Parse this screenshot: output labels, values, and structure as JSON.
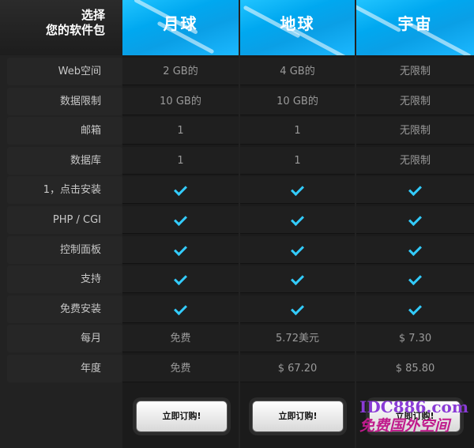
{
  "header": {
    "title_line1": "选择",
    "title_line2": "您的软件包",
    "plans": [
      "月球",
      "地球",
      "宇宙"
    ]
  },
  "rows": [
    {
      "label": "Web空间",
      "values": [
        "2 GB的",
        "4 GB的",
        "无限制"
      ]
    },
    {
      "label": "数据限制",
      "values": [
        "10 GB的",
        "10 GB的",
        "无限制"
      ]
    },
    {
      "label": "邮箱",
      "values": [
        "1",
        "1",
        "无限制"
      ]
    },
    {
      "label": "数据库",
      "values": [
        "1",
        "1",
        "无限制"
      ]
    },
    {
      "label": "1，点击安装",
      "values": [
        "check",
        "check",
        "check"
      ]
    },
    {
      "label": "PHP / CGI",
      "values": [
        "check",
        "check",
        "check"
      ]
    },
    {
      "label": "控制面板",
      "values": [
        "check",
        "check",
        "check"
      ]
    },
    {
      "label": "支持",
      "values": [
        "check",
        "check",
        "check"
      ]
    },
    {
      "label": "免费安装",
      "values": [
        "check",
        "check",
        "check"
      ]
    },
    {
      "label": "每月",
      "values": [
        "免费",
        "5.72美元",
        "$ 7.30"
      ]
    },
    {
      "label": "年度",
      "values": [
        "免费",
        "$ 67.20",
        "$ 85.80"
      ]
    }
  ],
  "buttons": {
    "order_label": "立即订购!"
  },
  "watermark": {
    "line1": "IDC886.com",
    "line2": "免费国外空间"
  },
  "colors": {
    "accent": "#00a8f0",
    "check": "#33ccff"
  }
}
